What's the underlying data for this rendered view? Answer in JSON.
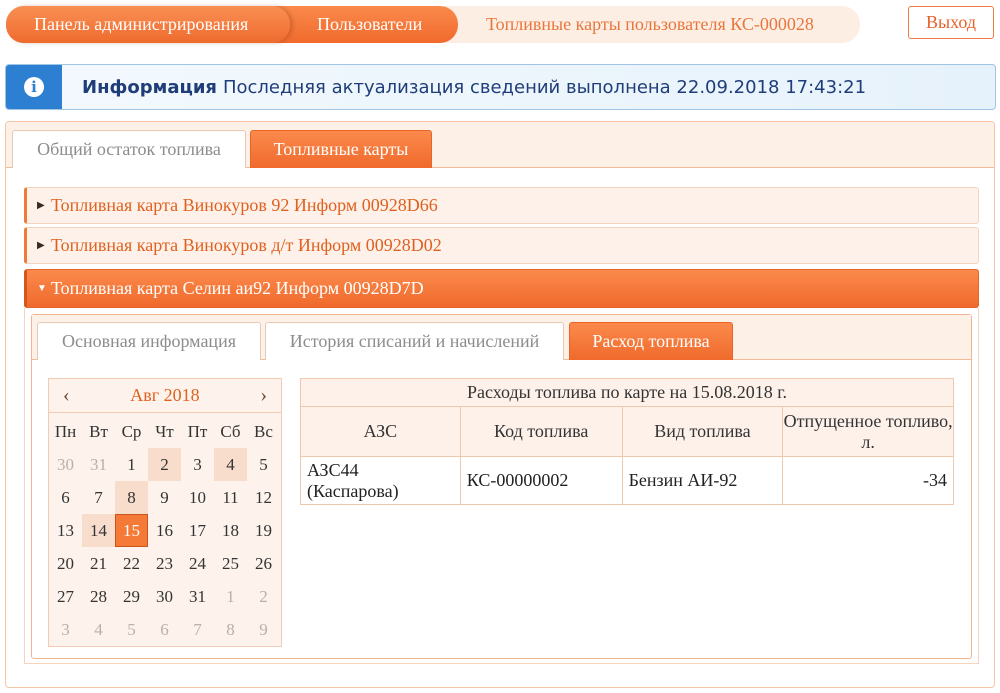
{
  "breadcrumb": {
    "items": [
      "Панель администрирования",
      "Пользователи",
      "Топливные карты пользователя КС-000028"
    ]
  },
  "header": {
    "exit_label": "Выход"
  },
  "alert": {
    "title": "Информация",
    "message": "Последняя актуализация сведений выполнена 22.09.2018 17:43:21",
    "icon": "info-icon"
  },
  "main_tabs": [
    {
      "label": "Общий остаток топлива",
      "active": false
    },
    {
      "label": "Топливные карты",
      "active": true
    }
  ],
  "cards": [
    {
      "title": "Топливная карта Винокуров 92 Информ 00928D66",
      "expanded": false
    },
    {
      "title": "Топливная карта Винокуров д/т Информ 00928D02",
      "expanded": false
    },
    {
      "title": "Топливная карта Селин аи92 Информ 00928D7D",
      "expanded": true
    }
  ],
  "inner_tabs": [
    {
      "label": "Основная информация",
      "active": false
    },
    {
      "label": "История списаний и начислений",
      "active": false
    },
    {
      "label": "Расход топлива",
      "active": true
    }
  ],
  "calendar": {
    "month_label": "Авг 2018",
    "prev": "‹",
    "next": "›",
    "weekdays": [
      "Пн",
      "Вт",
      "Ср",
      "Чт",
      "Пт",
      "Сб",
      "Вс"
    ],
    "weeks": [
      [
        "30",
        "31",
        "1",
        "2",
        "3",
        "4",
        "5"
      ],
      [
        "6",
        "7",
        "8",
        "9",
        "10",
        "11",
        "12"
      ],
      [
        "13",
        "14",
        "15",
        "16",
        "17",
        "18",
        "19"
      ],
      [
        "20",
        "21",
        "22",
        "23",
        "24",
        "25",
        "26"
      ],
      [
        "27",
        "28",
        "29",
        "30",
        "31",
        "1",
        "2"
      ],
      [
        "3",
        "4",
        "5",
        "6",
        "7",
        "8",
        "9"
      ]
    ],
    "selected": "15"
  },
  "table": {
    "caption": "Расходы топлива по карте на 15.08.2018 г.",
    "headers": [
      "АЗС",
      "Код топлива",
      "Вид топлива",
      "Отпущенное топливо, л."
    ],
    "rows": [
      {
        "station_line1": "АЗС44",
        "station_line2": "(Каспарова)",
        "fuel_code": "КС-00000002",
        "fuel_type": "Бензин АИ-92",
        "quantity": "-34"
      }
    ]
  },
  "colors": {
    "accent": "#f07a3a",
    "info": "#2d7fd2",
    "negative": "#d42020"
  }
}
